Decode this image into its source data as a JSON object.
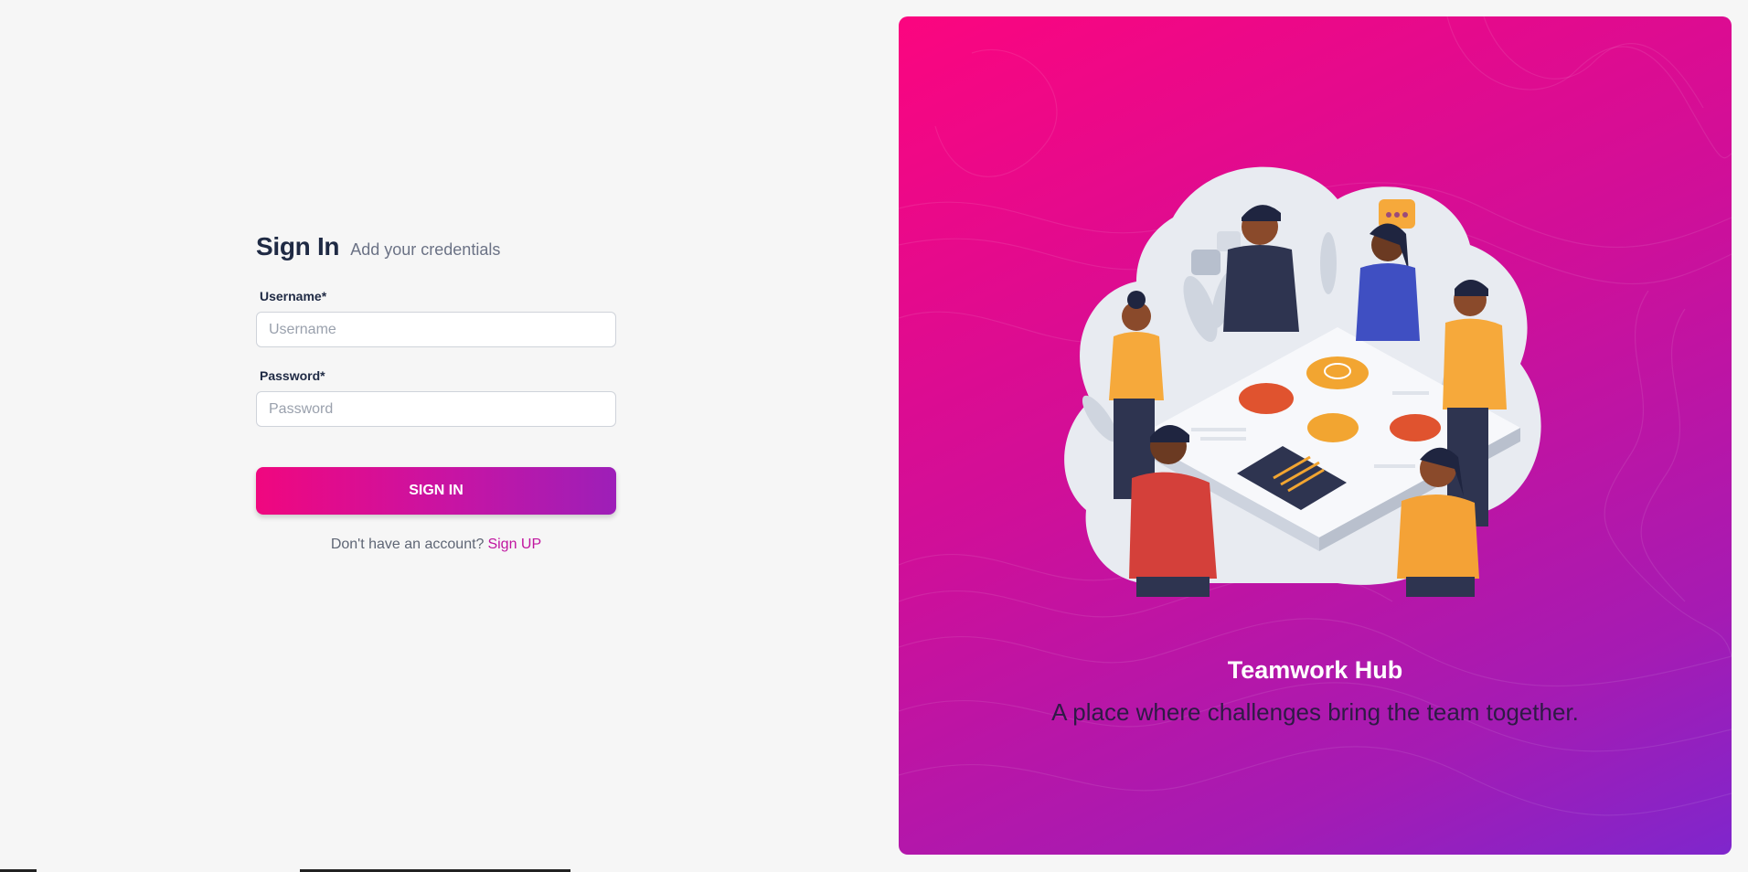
{
  "login": {
    "title": "Sign In",
    "subtitle": "Add your credentials",
    "username": {
      "label": "Username*",
      "placeholder": "Username",
      "value": ""
    },
    "password": {
      "label": "Password*",
      "placeholder": "Password",
      "value": ""
    },
    "submit_label": "SIGN IN",
    "signup_prompt": "Don't have an account?",
    "signup_link": "Sign UP"
  },
  "brand": {
    "name": "Teamwork Hub",
    "tagline": "A place where challenges bring the team together."
  },
  "colors": {
    "accent": "#f0077f",
    "accent_end": "#9d1fb8",
    "link": "#c0159f",
    "background": "#f6f6f6"
  },
  "icons": {
    "illustration": "team-collaboration-illustration"
  }
}
